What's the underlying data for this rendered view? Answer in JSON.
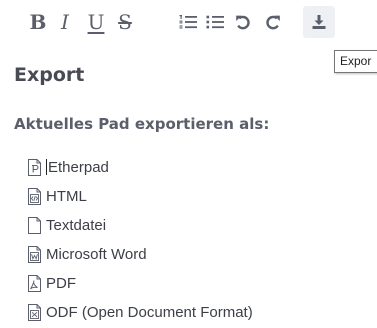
{
  "toolbar": {
    "bold_label": "B",
    "italic_label": "I",
    "underline_label": "U",
    "strike_label": "S",
    "buttons": {
      "ordered_list_icon": "ordered-list-icon",
      "unordered_list_icon": "unordered-list-icon",
      "undo_icon": "undo-icon",
      "redo_icon": "redo-icon",
      "export_icon": "download-icon"
    },
    "export_active": true
  },
  "tooltip": {
    "text": "Expor"
  },
  "export_popup": {
    "title": "Export",
    "subtitle": "Aktuelles Pad exportieren als:",
    "items": [
      {
        "label": "Etherpad",
        "icon": "file-etherpad-icon"
      },
      {
        "label": "HTML",
        "icon": "file-html-icon"
      },
      {
        "label": "Textdatei",
        "icon": "file-text-icon"
      },
      {
        "label": "Microsoft Word",
        "icon": "file-word-icon"
      },
      {
        "label": "PDF",
        "icon": "file-pdf-icon"
      },
      {
        "label": "ODF (Open Document Format)",
        "icon": "file-odf-icon"
      }
    ]
  },
  "colors": {
    "text": "#484b54",
    "icon": "#5b5f6b",
    "active_button_bg": "#eef0f3"
  }
}
